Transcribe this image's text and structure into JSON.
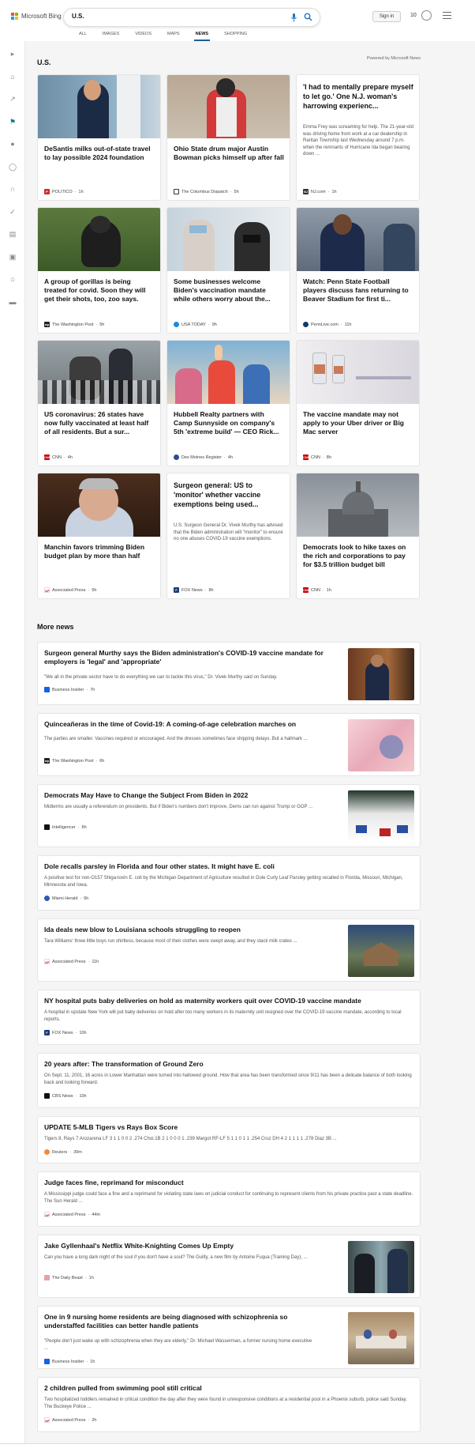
{
  "brand": {
    "logo_text": "Microsoft Bing"
  },
  "search": {
    "query": "U.S."
  },
  "header": {
    "sign_in": "Sign in",
    "points": "10"
  },
  "tabs": [
    "ALL",
    "IMAGES",
    "VIDEOS",
    "MAPS",
    "NEWS",
    "SHOPPING"
  ],
  "sidebar": {
    "icons": [
      "chevron-right-icon",
      "home-icon",
      "trending-icon",
      "flag-icon",
      "location-pin-icon",
      "globe-icon",
      "briefcase-icon",
      "science-icon",
      "entertainment-icon",
      "sports-icon",
      "politics-icon",
      "money-icon"
    ]
  },
  "section": {
    "title": "U.S.",
    "powered_by": "Powered by Microsoft News"
  },
  "cards": [
    {
      "title": "DeSantis milks out-of-state travel to lay possible 2024 foundation",
      "source": "POLITICO",
      "time": "1h"
    },
    {
      "title": "Ohio State drum major Austin Bowman picks himself up after fall",
      "source": "The Columbus Dispatch",
      "time": "5h"
    },
    {
      "title": "'I had to mentally prepare myself to let go.' One N.J. woman's harrowing experienc...",
      "snippet": "Emma Frey was screaming for help. The 21-year-old was driving home from work at a car dealership in Raritan Township last Wednesday around 7 p.m. when the remnants of Hurricane Ida began bearing down ...",
      "source": "NJ.com",
      "time": "1h"
    },
    {
      "title": "A group of gorillas is being treated for covid. Soon they will get their shots, too, zoo says.",
      "source": "The Washington Post",
      "time": "5h"
    },
    {
      "title": "Some businesses welcome Biden's vaccination mandate while others worry about the...",
      "source": "USA TODAY",
      "time": "9h"
    },
    {
      "title": "Watch: Penn State Football players discuss fans returning to Beaver Stadium for first ti...",
      "source": "PennLive.com",
      "time": "11h"
    },
    {
      "title": "US coronavirus: 26 states have now fully vaccinated at least half of all residents. But a sur...",
      "source": "CNN",
      "time": "4h"
    },
    {
      "title": "Hubbell Realty partners with Camp Sunnyside on company's 5th 'extreme build' — CEO Rick...",
      "source": "Des Moines Register",
      "time": "4h"
    },
    {
      "title": "The vaccine mandate may not apply to your Uber driver or Big Mac server",
      "source": "CNN",
      "time": "8h"
    },
    {
      "title": "Manchin favors trimming Biden budget plan by more than half",
      "source": "Associated Press",
      "time": "5h"
    },
    {
      "title": "Surgeon general: US to 'monitor' whether vaccine exemptions being used...",
      "snippet": "U.S. Surgeon General Dr. Vivek Murthy has advised that the Biden administration will \"monitor\" to ensure no one abuses COVID-19 vaccine exemptions.",
      "source": "FOX News",
      "time": "8h"
    },
    {
      "title": "Democrats look to hike taxes on the rich and corporations to pay for $3.5 trillion budget bill",
      "source": "CNN",
      "time": "1h"
    }
  ],
  "more_news": {
    "title": "More news",
    "items": [
      {
        "title": "Surgeon general Murthy says the Biden administration's COVID-19 vaccine mandate for employers is 'legal' and 'appropriate'",
        "snippet": "\"We all in the private sector have to do everything we can to tackle this virus,\" Dr. Vivek Murthy said on Sunday.",
        "source": "Business Insider",
        "time": "7h"
      },
      {
        "title": "Quinceañeras in the time of Covid-19: A coming-of-age celebration marches on",
        "snippet": "The parties are smaller. Vaccines required or encouraged. And the dresses sometimes face shipping delays. But a hallmark ...",
        "source": "The Washington Post",
        "time": "6h"
      },
      {
        "title": "Democrats May Have to Change the Subject From Biden in 2022",
        "snippet": "Midterms are usually a referendum on presidents. But if Biden's numbers don't improve, Dems can run against Trump or GOP ...",
        "source": "Intelligencer",
        "time": "8h"
      },
      {
        "title": "Dole recalls parsley in Florida and four other states. It might have E. coli",
        "snippet": "A positive test for non-O157 Shiga-toxin E. coli by the Michigan Department of Agriculture resulted in Dole Curly Leaf Parsley getting recalled in Florida, Missouri, Michigan, Minnesota and Iowa.",
        "source": "Miami Herald",
        "time": "6h"
      },
      {
        "title": "Ida deals new blow to Louisiana schools struggling to reopen",
        "snippet": "Tara Williams' three little boys run shirtless, because most of their clothes were swept away, and they stack milk crates ...",
        "source": "Associated Press",
        "time": "11h"
      },
      {
        "title": "NY hospital puts baby deliveries on hold as maternity workers quit over COVID-19 vaccine mandate",
        "snippet": "A hospital in upstate New York will put baby deliveries on hold after too many workers in its maternity unit resigned over the COVID-19 vaccine mandate, according to local reports.",
        "source": "FOX News",
        "time": "10h"
      },
      {
        "title": "20 years after: The transformation of Ground Zero",
        "snippet": "On Sept. 11, 2001, 16 acres in Lower Manhattan were turned into hallowed ground. How that area has been transformed since 9/11 has been a delicate balance of both looking back and looking forward.",
        "source": "CBS News",
        "time": "10h"
      },
      {
        "title": "UPDATE 5-MLB Tigers vs Rays Box Score",
        "snippet": "Tigers 8, Rays 7 Arozarena LF 3 1 1 0 0 2 .274 Choi.1B 2 1 0 0 0 1 .239 Margot RF-LF 5 1 1 0 1 1 .254 Cruz DH 4 2 1 1 1 1 .278 Diaz 3B ...",
        "source": "Reuters",
        "time": "39m"
      },
      {
        "title": "Judge faces fine, reprimand for misconduct",
        "snippet": "A Mississippi judge could face a fine and a reprimand for violating state laws on judicial conduct for continuing to represent clients from his private practice past a state deadline. The Sun Herald ...",
        "source": "Associated Press",
        "time": "44m"
      },
      {
        "title": "Jake Gyllenhaal's Netflix White-Knighting Comes Up Empty",
        "snippet": "Can you have a long dark night of the soul if you don't have a soul? The Guilty, a new film by Antoine Fuqua (Training Day), ...",
        "source": "The Daily Beast",
        "time": "1h"
      },
      {
        "title": "One in 9 nursing home residents are being diagnosed with schizophrenia so understaffed facilities can better handle patients",
        "snippet": "\"People don't just wake up with schizophrenia when they are elderly,\" Dr. Michael Wasserman, a former nursing home executive ...",
        "source": "Business Insider",
        "time": "1h"
      },
      {
        "title": "2 children pulled from swimming pool still critical",
        "snippet": "Two hospitalized toddlers remained in critical condition the day after they were found in unresponsive conditions at a residential pool in a Phoenix suburb, police said Sunday. The Buckeye Police ...",
        "source": "Associated Press",
        "time": "2h"
      }
    ]
  }
}
